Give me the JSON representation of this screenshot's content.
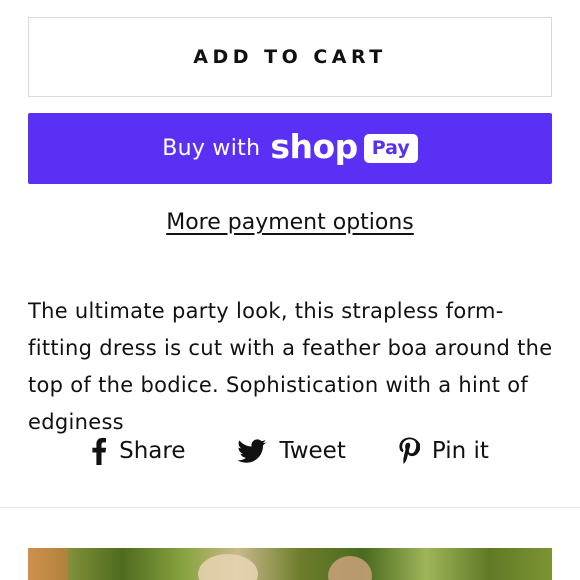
{
  "cart": {
    "add_label": "ADD TO CART"
  },
  "payment": {
    "buy_with": "Buy with",
    "shop_word": "shop",
    "pay_badge": "Pay",
    "more_options": "More payment options",
    "accent": "#5a31f4"
  },
  "description": {
    "text": "The ultimate party look, this strapless form-fitting dress is cut with a feather boa around the top of the bodice. Sophistication with a hint of edginess"
  },
  "share": {
    "items": [
      {
        "label": "Share",
        "icon": "facebook-icon"
      },
      {
        "label": "Tweet",
        "icon": "twitter-icon"
      },
      {
        "label": "Pin it",
        "icon": "pinterest-icon"
      }
    ]
  }
}
